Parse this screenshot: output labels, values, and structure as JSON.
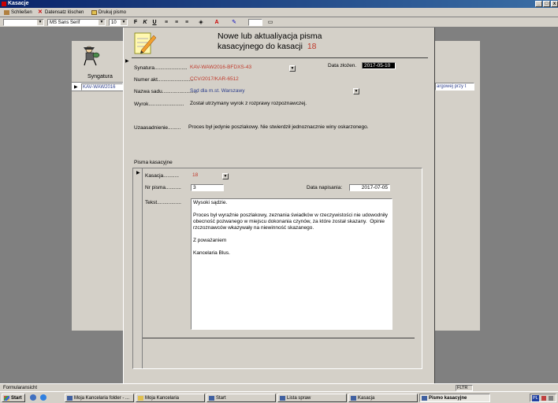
{
  "window": {
    "title": "Kasacje"
  },
  "toolbar1": {
    "close_label": "Schließen",
    "delete_label": "Datensatz löschen",
    "print_label": "Drukuj pismo"
  },
  "toolbar2": {
    "font_name": "MS Sans Serif",
    "font_size": "10",
    "bold": "F",
    "italic": "K",
    "underline": "U"
  },
  "background_form": {
    "column_header": "Syngatura",
    "row_value": "KAV-WAW2016",
    "right_value": "argowej przy t"
  },
  "form": {
    "title_line1": "Nowe lub aktualiyacja pisma",
    "title_line2": "kasacyjnego do kasacji",
    "kasacja_number": "18",
    "labels": {
      "sygnatura": "Synatura.......................",
      "numer_akt": "Numer akt.........................",
      "nazwa_sadu": "Nazwa sadu.........................",
      "wyrok": "Wyrok.........................",
      "uzasadnienie": "Uzaasadnienie.........",
      "data_zlozenia": "Data złożen."
    },
    "values": {
      "sygnatura": "KAV-WAW2016-BFDXS-43",
      "numer_akt": "CCV/2017/KAR-6512",
      "nazwa_sadu": "Sąd dla m.st. Warszawy",
      "wyrok": "Został utrzymany wyrok z rozprawy rozpoznawczej.",
      "uzasadnienie": "Proces był jedynie poszlakowy.  Nie stwierdził jednoznacznie winy oskarzonego.",
      "data_zlozenia": "2017-05-10"
    }
  },
  "subform": {
    "section_label": "Pisma kasacyjne",
    "labels": {
      "kasacja": "Kasacja...........",
      "nr_pisma": "Nr pisma...........",
      "data_napisania": "Data napisania:",
      "tekst": "Tekst................."
    },
    "values": {
      "kasacja": "18",
      "nr_pisma": "3",
      "data_napisania": "2017-07-05",
      "tekst": "Wysoki sądzie.\n\nProces był wyraźnie poszlakowy, zeznania świadków w rzeczywistości nie udowodniły obecność pozwanego w miejscu dokonania czynów, za które został skazany.  Opinie rzczoznawców wkazywały na niewinność skazanego.\n\nZ poważaniem\n\nKancelaria Blus."
    }
  },
  "statusbar": {
    "left": "Formularansicht",
    "right": "FLTR"
  },
  "taskbar": {
    "start": "Start",
    "tasks": [
      "Moja Kancelaria folder - ...",
      "Moja Kancelaria",
      "Start",
      "Lista spraw",
      "Kasacja",
      "Pismo kasacyjne"
    ],
    "tray_text": "PL"
  },
  "colors": {
    "title_bar": "#0a246a",
    "window_bg": "#d4d0c8",
    "accent_red": "#c0392b",
    "desktop_gray": "#808080"
  }
}
